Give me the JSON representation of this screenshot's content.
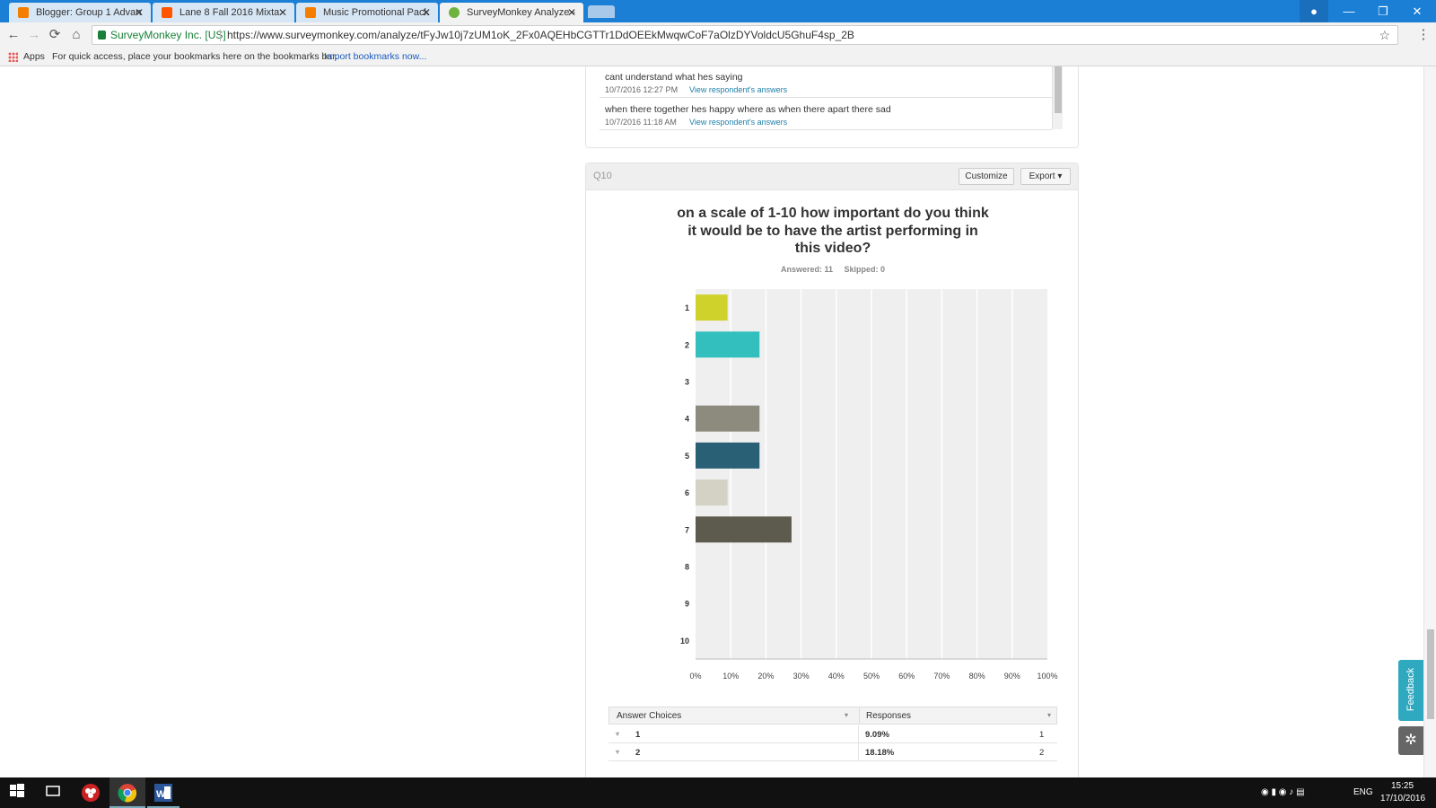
{
  "browser": {
    "tabs": [
      {
        "title": "Blogger: Group 1 Advan",
        "icon_color": "#f57d00",
        "icon": "blogger-icon"
      },
      {
        "title": "Lane 8 Fall 2016 Mixta",
        "icon_color": "#ff5500",
        "icon": "soundcloud-icon"
      },
      {
        "title": "Music Promotional Pack",
        "icon_color": "#f57d00",
        "icon": "blogger-icon"
      },
      {
        "title": "SurveyMonkey Analyze -",
        "icon_color": "#6fb33f",
        "icon": "surveymonkey-icon"
      }
    ],
    "close_glyph": "✕",
    "window_buttons": {
      "minimize": "—",
      "restore": "❐",
      "close": "✕"
    },
    "secure_label": "SurveyMonkey Inc. [US]",
    "url": "https://www.surveymonkey.com/analyze/tFyJw10j7zUM1oK_2Fx0AQEHbCGTTr1DdOEEkMwqwCoF7aOlzDYVoldcU5GhuF4sp_2B",
    "nav": {
      "back": "←",
      "forward": "→",
      "reload": "⟳",
      "home": "⌂",
      "star": "☆",
      "menu": "⋮"
    },
    "bookmarks_bar": {
      "apps_label": "Apps",
      "hint": "For quick access, place your bookmarks here on the bookmarks bar.",
      "import_link": "Import bookmarks now..."
    }
  },
  "previous_responses": [
    {
      "text": "cant understand what hes saying",
      "date": "10/7/2016 12:27 PM",
      "link": "View respondent's answers"
    },
    {
      "text": "when there together hes happy where as when there apart there sad",
      "date": "10/7/2016 11:18 AM",
      "link": "View respondent's answers"
    }
  ],
  "question": {
    "number": "Q10",
    "customize_label": "Customize",
    "export_label": "Export ▾",
    "title": "on a scale of 1-10 how important do you think it would be to have the artist performing in this video?",
    "answered": "Answered: 11",
    "skipped": "Skipped: 0"
  },
  "chart_data": {
    "type": "bar",
    "orientation": "horizontal",
    "categories": [
      "1",
      "2",
      "3",
      "4",
      "5",
      "6",
      "7",
      "8",
      "9",
      "10"
    ],
    "values": [
      9.09,
      18.18,
      0,
      18.18,
      18.18,
      9.09,
      27.27,
      0,
      0,
      0
    ],
    "colors": [
      "#cfd22a",
      "#34bfbf",
      "#cccccc",
      "#8c8b7e",
      "#2a6075",
      "#d3d2c4",
      "#5c5b4d",
      "#cccccc",
      "#cccccc",
      "#cccccc"
    ],
    "xticks": [
      "0%",
      "10%",
      "20%",
      "30%",
      "40%",
      "50%",
      "60%",
      "70%",
      "80%",
      "90%",
      "100%"
    ],
    "xlim": [
      0,
      100
    ],
    "grid": true
  },
  "table": {
    "headers": [
      "Answer Choices",
      "Responses"
    ],
    "sort_glyph": "▾",
    "rows": [
      {
        "choice": "1",
        "percent": "9.09%",
        "count": "1"
      },
      {
        "choice": "2",
        "percent": "18.18%",
        "count": "2"
      }
    ]
  },
  "feedback_label": "Feedback",
  "bug_glyph": "✲",
  "taskbar": {
    "time": "15:25",
    "date": "17/10/2016",
    "lang": "ENG"
  }
}
